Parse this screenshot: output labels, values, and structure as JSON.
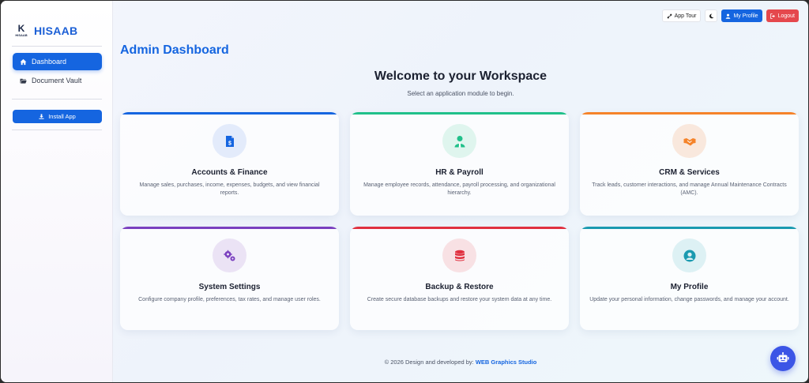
{
  "brand": {
    "name": "HISAAB",
    "logo_letter": "K",
    "logo_caption": "HISAAB"
  },
  "sidebar": {
    "items": [
      {
        "label": "Dashboard",
        "icon": "home-icon",
        "active": true
      },
      {
        "label": "Document Vault",
        "icon": "folder-icon",
        "active": false
      }
    ],
    "install_label": "Install App"
  },
  "topbar": {
    "tour_label": "App Tour",
    "profile_label": "My Profile",
    "logout_label": "Logout"
  },
  "main": {
    "page_title": "Admin Dashboard",
    "welcome": "Welcome to your Workspace",
    "subtitle": "Select an application module to begin.",
    "cards": [
      {
        "title": "Accounts & Finance",
        "desc": "Manage sales, purchases, income, expenses, budgets, and view financial reports.",
        "icon": "invoice-dollar-icon",
        "color": "#1565e0",
        "bg": "#e3ebfb"
      },
      {
        "title": "HR & Payroll",
        "desc": "Manage employee records, attendance, payroll processing, and organizational hierarchy.",
        "icon": "user-tie-icon",
        "color": "#20c08a",
        "bg": "#dff5ee"
      },
      {
        "title": "CRM & Services",
        "desc": "Track leads, customer interactions, and manage Annual Maintenance Contracts (AMC).",
        "icon": "handshake-icon",
        "color": "#f5832a",
        "bg": "#f9e8dd"
      },
      {
        "title": "System Settings",
        "desc": "Configure company profile, preferences, tax rates, and manage user roles.",
        "icon": "gears-icon",
        "color": "#7a3fbf",
        "bg": "#ebe3f5"
      },
      {
        "title": "Backup & Restore",
        "desc": "Create secure database backups and restore your system data at any time.",
        "icon": "database-icon",
        "color": "#e0303f",
        "bg": "#f8e1e4"
      },
      {
        "title": "My Profile",
        "desc": "Update your personal information, change passwords, and manage your account.",
        "icon": "user-circle-icon",
        "color": "#1a9ab0",
        "bg": "#ddf1f4"
      }
    ]
  },
  "footer": {
    "text": "© 2026 Design and developed by: ",
    "studio": "WEB Graphics Studio"
  }
}
